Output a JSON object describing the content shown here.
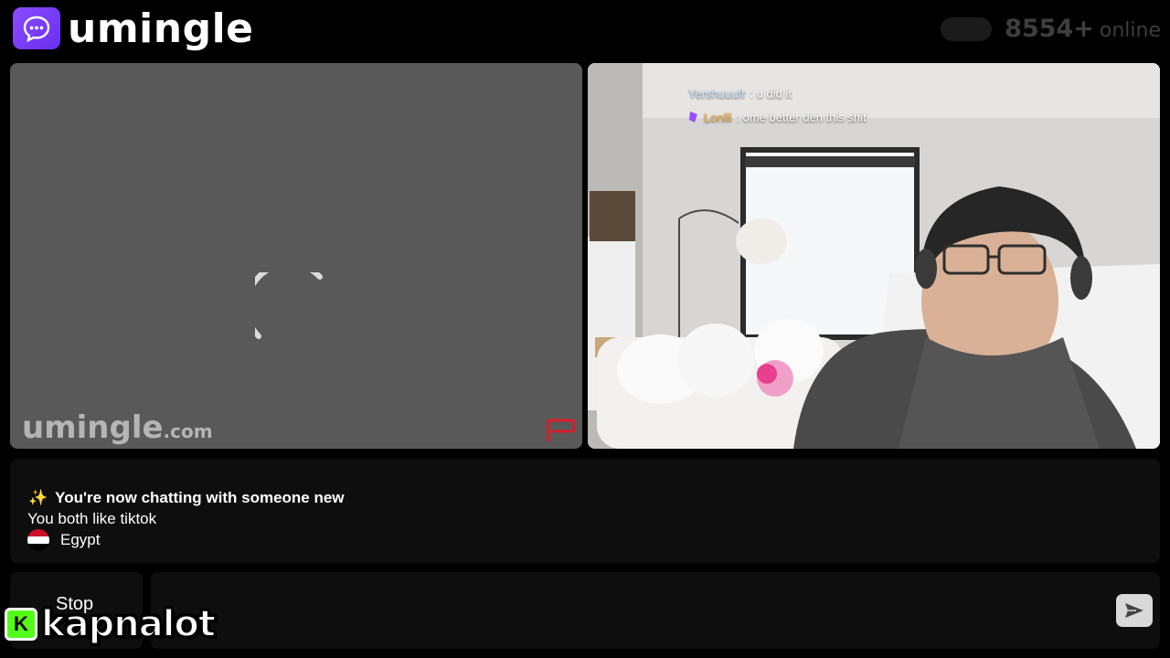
{
  "header": {
    "brand": "umingle",
    "online_count": "8554+",
    "online_label": "online",
    "logo_icon": "chat-bubble-icon",
    "colors": {
      "brand_purple": "#7b3ff7"
    }
  },
  "stranger_panel": {
    "watermark_name": "umingle",
    "watermark_tld": ".com",
    "status": "loading",
    "report_icon": "flag-icon",
    "report_color": "#d81b2a"
  },
  "self_panel": {
    "chat_overlay": [
      {
        "name": "Yershuuufr",
        "message": ": u did it"
      },
      {
        "name": "Lonlll",
        "message": ": ome better den this shit",
        "badge_icon": "purple-badge-icon"
      }
    ]
  },
  "info": {
    "icon": "sparkles-icon",
    "title": "You're now chatting with someone new",
    "interest": "You both like tiktok",
    "country": "Egypt",
    "country_icon": "egypt-flag-icon"
  },
  "controls": {
    "stop_label": "Stop",
    "send_icon": "send-arrow-icon"
  },
  "streamer_overlay": {
    "platform_icon": "kick-logo-icon",
    "platform_letter": "K",
    "username": "kapnalot"
  }
}
